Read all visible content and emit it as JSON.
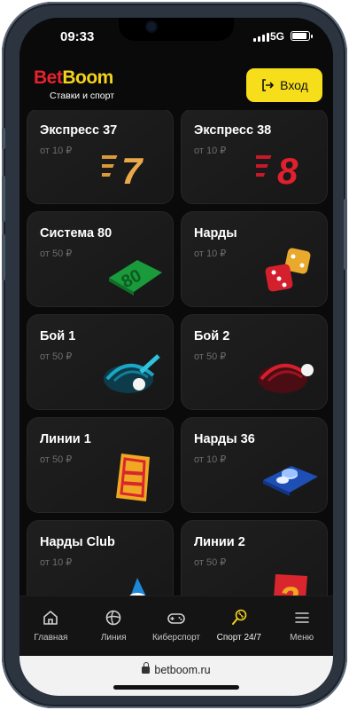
{
  "status_bar": {
    "time": "09:33",
    "network": "5G",
    "battery_level": 0.9
  },
  "header": {
    "logo_part1": "Bet",
    "logo_part2": "Boom",
    "tagline": "Ставки и спорт",
    "login_label": "Вход"
  },
  "games": [
    {
      "title": "Экспресс 37",
      "price": "от 10 ₽",
      "art": "express-37"
    },
    {
      "title": "Экспресс 38",
      "price": "от 10 ₽",
      "art": "express-38"
    },
    {
      "title": "Система 80",
      "price": "от 50 ₽",
      "art": "system-80"
    },
    {
      "title": "Нарды",
      "price": "от 10 ₽",
      "art": "dice"
    },
    {
      "title": "Бой 1",
      "price": "от 50 ₽",
      "art": "fight-1"
    },
    {
      "title": "Бой 2",
      "price": "от 50 ₽",
      "art": "fight-2"
    },
    {
      "title": "Линии 1",
      "price": "от 50 ₽",
      "art": "lines-1"
    },
    {
      "title": "Нарды 36",
      "price": "от 10 ₽",
      "art": "backgammon-36"
    },
    {
      "title": "Нарды Club",
      "price": "от 10 ₽",
      "art": "backgammon-club"
    },
    {
      "title": "Линии 2",
      "price": "от 50 ₽",
      "art": "lines-2"
    }
  ],
  "nav": {
    "items": [
      {
        "label": "Главная",
        "icon": "home-icon"
      },
      {
        "label": "Линия",
        "icon": "ball-icon"
      },
      {
        "label": "Киберспорт",
        "icon": "gamepad-icon"
      },
      {
        "label": "Спорт 24/7",
        "icon": "racket-icon"
      },
      {
        "label": "Меню",
        "icon": "menu-icon"
      }
    ],
    "active_index": 3
  },
  "browser": {
    "url": "betboom.ru"
  },
  "colors": {
    "brand_red": "#e8222d",
    "brand_yellow": "#f5d31b",
    "button_yellow": "#f6de1b",
    "background": "#0a0a0a",
    "card": "#1c1c1c"
  }
}
